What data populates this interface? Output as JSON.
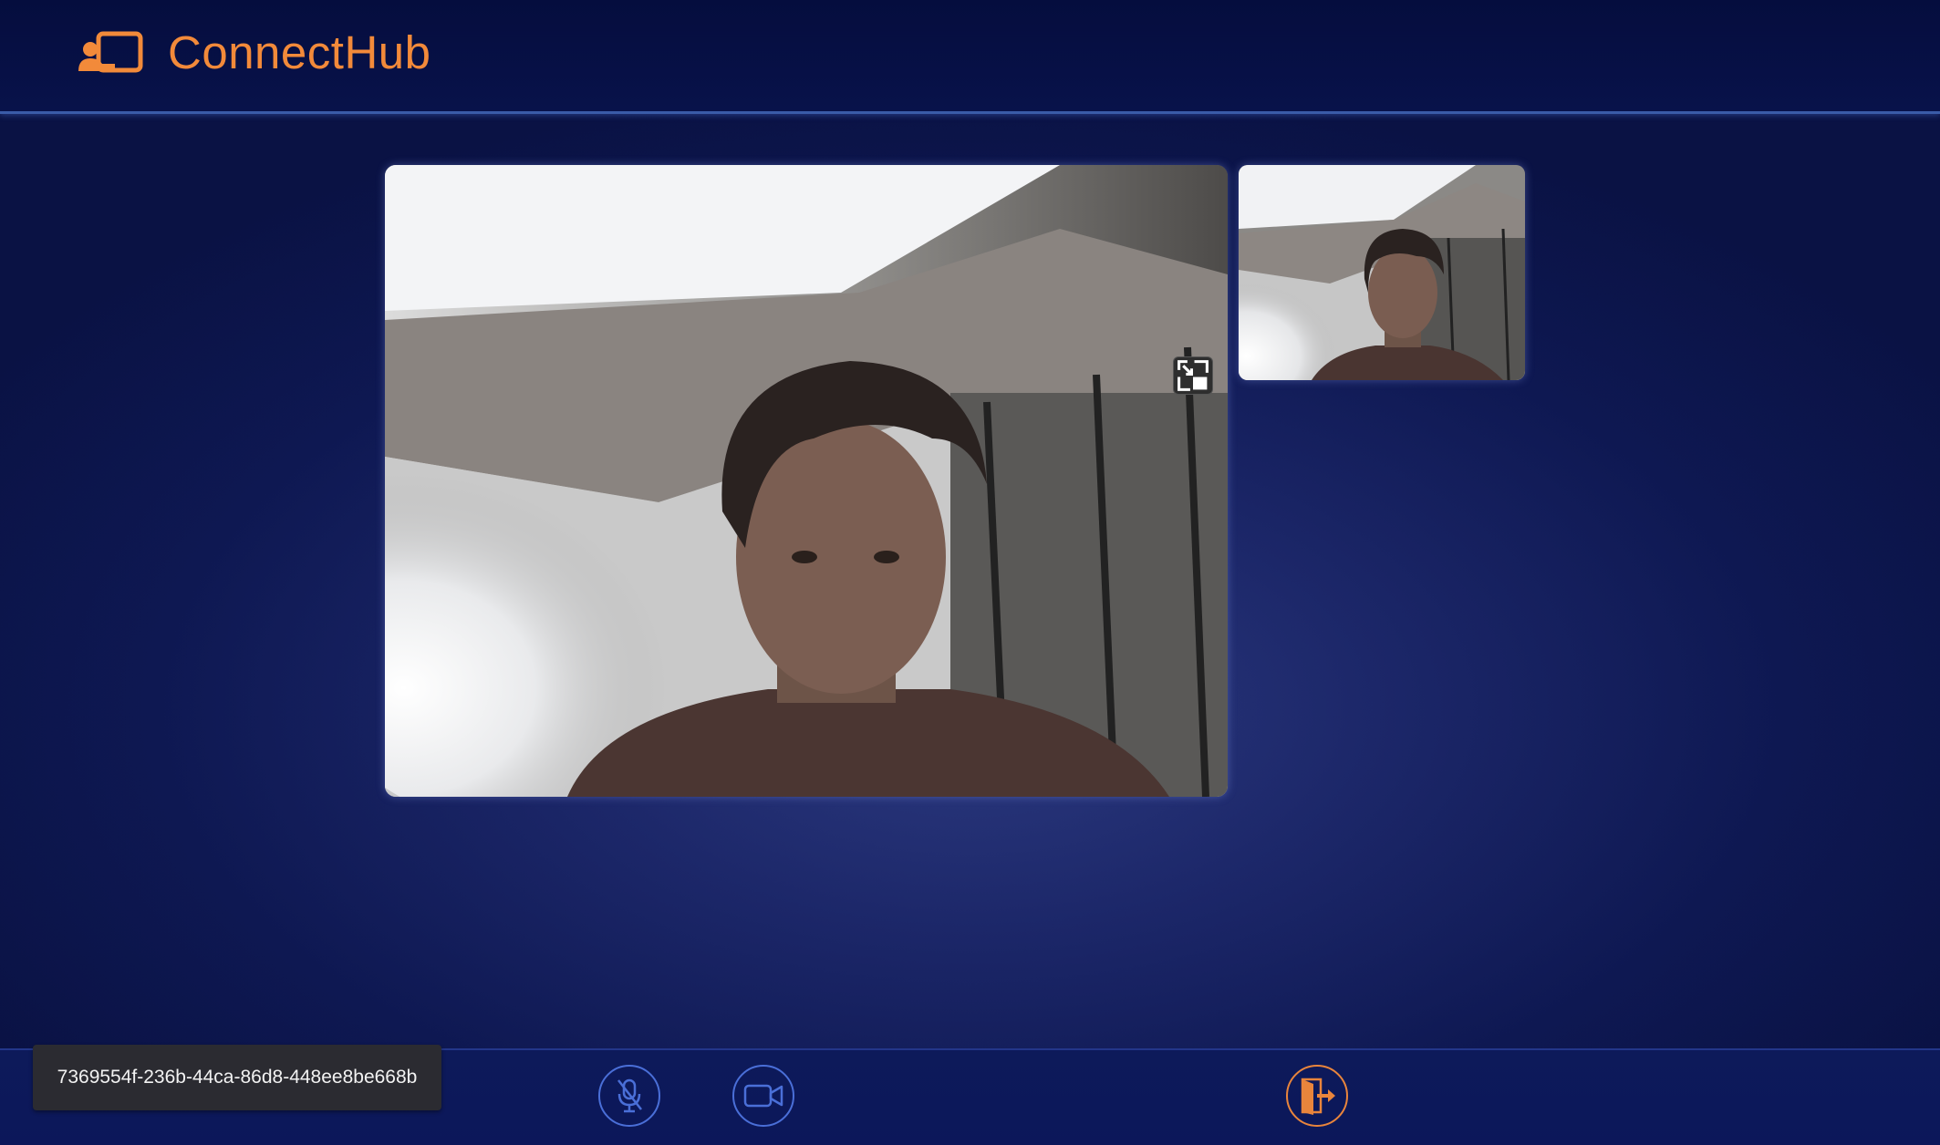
{
  "header": {
    "app_name": "ConnectHub",
    "logo_icon": "presenter-screen-icon",
    "brand_color": "#f28a3a"
  },
  "videos": {
    "main_icon": "picture-in-picture-icon",
    "side_label": ""
  },
  "footer": {
    "meeting_id": "7369554f-236b-44ca-86d8-448ee8be668b",
    "mic_icon": "mic-off-icon",
    "camera_icon": "video-camera-icon",
    "leave_icon": "exit-door-icon",
    "control_color": "#4a6fd8",
    "leave_color": "#e9853c"
  }
}
